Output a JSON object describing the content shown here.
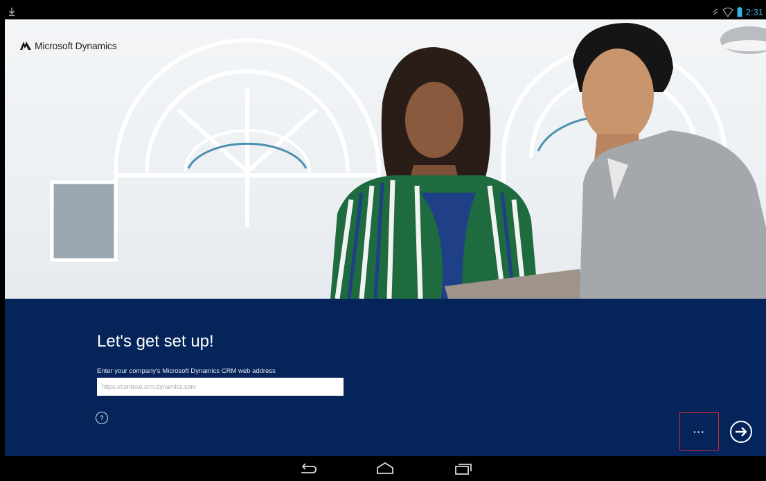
{
  "status_bar": {
    "time": "2:31",
    "icons": [
      "download-icon",
      "wifi-icon",
      "battery-icon"
    ]
  },
  "hero": {
    "logo_text": "Microsoft Dynamics"
  },
  "setup": {
    "title": "Let's get set up!",
    "field_label": "Enter your company's Microsoft Dynamics CRM web address",
    "url_value": "",
    "url_placeholder": "https://contoso.crm.dynamics.com",
    "help_label": "?",
    "more_label": "···",
    "next_icon": "arrow-right-circle-icon"
  },
  "nav_bar": {
    "buttons": [
      "back-icon",
      "home-icon",
      "recent-apps-icon"
    ]
  },
  "colors": {
    "panel_bg": "#04245a",
    "status_accent": "#35b5e5",
    "highlight_border": "#d2283a"
  }
}
